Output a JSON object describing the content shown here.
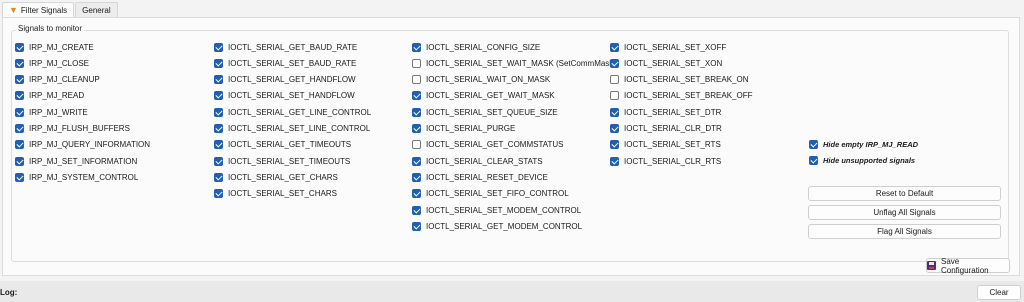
{
  "tabs": [
    {
      "label": "Filter Signals",
      "icon": "filter-icon",
      "active": true
    },
    {
      "label": "General",
      "active": false
    }
  ],
  "group_title": "Signals to monitor",
  "columns": [
    [
      {
        "label": "IRP_MJ_CREATE",
        "checked": true
      },
      {
        "label": "IRP_MJ_CLOSE",
        "checked": true
      },
      {
        "label": "IRP_MJ_CLEANUP",
        "checked": true
      },
      {
        "label": "IRP_MJ_READ",
        "checked": true
      },
      {
        "label": "IRP_MJ_WRITE",
        "checked": true
      },
      {
        "label": "IRP_MJ_FLUSH_BUFFERS",
        "checked": true
      },
      {
        "label": "IRP_MJ_QUERY_INFORMATION",
        "checked": true
      },
      {
        "label": "IRP_MJ_SET_INFORMATION",
        "checked": true
      },
      {
        "label": "IRP_MJ_SYSTEM_CONTROL",
        "checked": true
      }
    ],
    [
      {
        "label": "IOCTL_SERIAL_GET_BAUD_RATE",
        "checked": true
      },
      {
        "label": "IOCTL_SERIAL_SET_BAUD_RATE",
        "checked": true
      },
      {
        "label": "IOCTL_SERIAL_GET_HANDFLOW",
        "checked": true
      },
      {
        "label": "IOCTL_SERIAL_SET_HANDFLOW",
        "checked": true
      },
      {
        "label": "IOCTL_SERIAL_GET_LINE_CONTROL",
        "checked": true
      },
      {
        "label": "IOCTL_SERIAL_SET_LINE_CONTROL",
        "checked": true
      },
      {
        "label": "IOCTL_SERIAL_GET_TIMEOUTS",
        "checked": true
      },
      {
        "label": "IOCTL_SERIAL_SET_TIMEOUTS",
        "checked": true
      },
      {
        "label": "IOCTL_SERIAL_GET_CHARS",
        "checked": true
      },
      {
        "label": "IOCTL_SERIAL_SET_CHARS",
        "checked": true
      }
    ],
    [
      {
        "label": "IOCTL_SERIAL_CONFIG_SIZE",
        "checked": true
      },
      {
        "label": "IOCTL_SERIAL_SET_WAIT_MASK (SetCommMask)",
        "checked": false
      },
      {
        "label": "IOCTL_SERIAL_WAIT_ON_MASK",
        "checked": false
      },
      {
        "label": "IOCTL_SERIAL_GET_WAIT_MASK",
        "checked": true
      },
      {
        "label": "IOCTL_SERIAL_SET_QUEUE_SIZE",
        "checked": true
      },
      {
        "label": "IOCTL_SERIAL_PURGE",
        "checked": true
      },
      {
        "label": "IOCTL_SERIAL_GET_COMMSTATUS",
        "checked": false
      },
      {
        "label": "IOCTL_SERIAL_CLEAR_STATS",
        "checked": true
      },
      {
        "label": "IOCTL_SERIAL_RESET_DEVICE",
        "checked": true
      },
      {
        "label": "IOCTL_SERIAL_SET_FIFO_CONTROL",
        "checked": true
      },
      {
        "label": "IOCTL_SERIAL_SET_MODEM_CONTROL",
        "checked": true
      },
      {
        "label": "IOCTL_SERIAL_GET_MODEM_CONTROL",
        "checked": true
      }
    ],
    [
      {
        "label": "IOCTL_SERIAL_SET_XOFF",
        "checked": true
      },
      {
        "label": "IOCTL_SERIAL_SET_XON",
        "checked": true
      },
      {
        "label": "IOCTL_SERIAL_SET_BREAK_ON",
        "checked": false
      },
      {
        "label": "IOCTL_SERIAL_SET_BREAK_OFF",
        "checked": false
      },
      {
        "label": "IOCTL_SERIAL_SET_DTR",
        "checked": true
      },
      {
        "label": "IOCTL_SERIAL_CLR_DTR",
        "checked": true
      },
      {
        "label": "IOCTL_SERIAL_SET_RTS",
        "checked": true
      },
      {
        "label": "IOCTL_SERIAL_CLR_RTS",
        "checked": true
      }
    ]
  ],
  "options": [
    {
      "label": "Hide empty IRP_MJ_READ",
      "checked": true
    },
    {
      "label": "Hide unsupported signals",
      "checked": true
    }
  ],
  "buttons": {
    "reset": "Reset to Default",
    "unflag": "Unflag All Signals",
    "flag": "Flag All Signals",
    "save": "Save Configuration",
    "clear": "Clear"
  },
  "log_label": "Log:",
  "colors": {
    "accent": "#1f5fb4"
  }
}
